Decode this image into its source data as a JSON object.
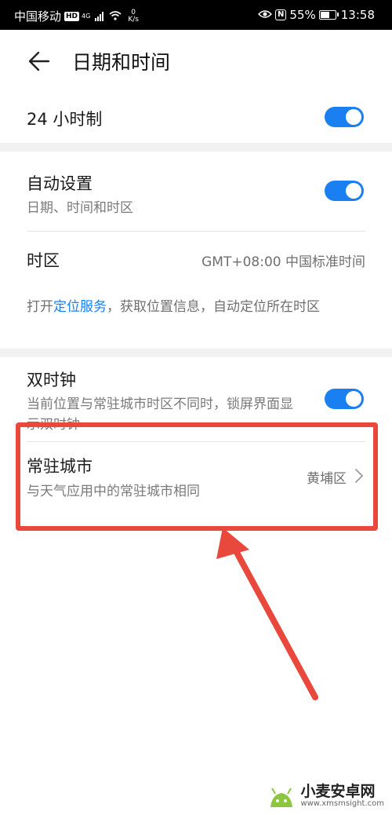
{
  "status_bar": {
    "carrier": "中国移动",
    "hd": "HD",
    "net_type": "4G",
    "speed_value": "0",
    "speed_unit": "K/s",
    "battery_percent": "55%",
    "time": "13:58"
  },
  "header": {
    "title": "日期和时间",
    "back_icon": "arrow-left-icon"
  },
  "settings": {
    "hour24": {
      "label": "24 小时制",
      "enabled": true
    },
    "auto_set": {
      "label": "自动设置",
      "sublabel": "日期、时间和时区",
      "enabled": true
    },
    "timezone": {
      "label": "时区",
      "value": "GMT+08:00 中国标准时间"
    },
    "location_info": {
      "prefix": "打开",
      "link": "定位服务",
      "suffix": "，获取位置信息，自动定位所在时区"
    },
    "dual_clock": {
      "label": "双时钟",
      "sublabel": "当前位置与常驻城市时区不同时，锁屏界面显示双时钟",
      "enabled": true
    },
    "home_city": {
      "label": "常驻城市",
      "sublabel": "与天气应用中的常驻城市相同",
      "value": "黄埔区"
    }
  },
  "annotation": {
    "highlight_color": "#e8493c"
  },
  "colors": {
    "accent": "#1a7ff0",
    "section_gap": "#f1f1f1"
  },
  "watermark": {
    "name": "小麦安卓网",
    "url": "www.xmsmsight.com"
  }
}
